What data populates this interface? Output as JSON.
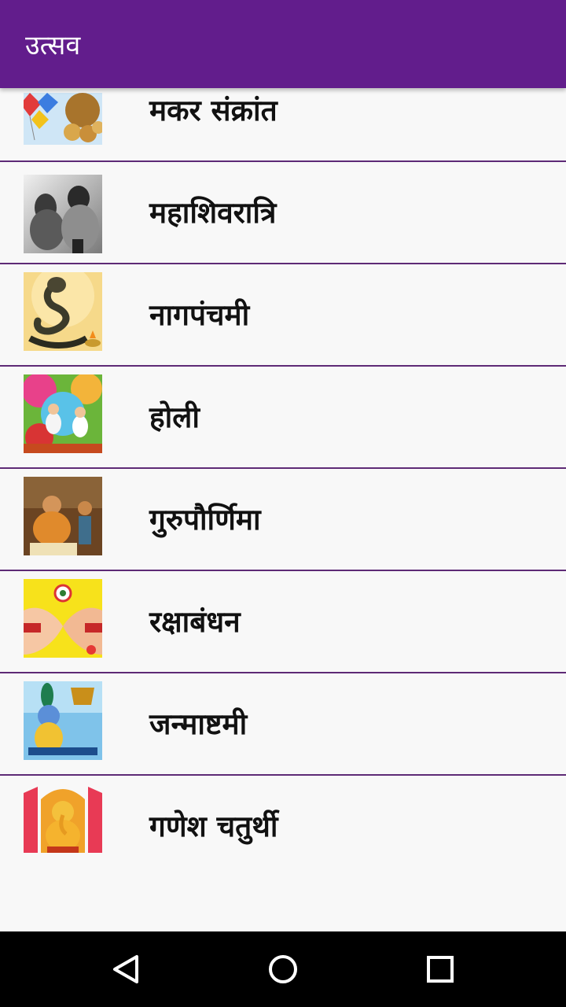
{
  "app_bar": {
    "title": "उत्सव",
    "color": "#621d8c"
  },
  "festivals": [
    {
      "name": "मकर संक्रांत",
      "icon": "kites-sweets-image"
    },
    {
      "name": "महाशिवरात्रि",
      "icon": "shiva-parvati-image"
    },
    {
      "name": "नागपंचमी",
      "icon": "cobra-lamp-image"
    },
    {
      "name": "होली",
      "icon": "holi-celebration-image"
    },
    {
      "name": "गुरुपौर्णिमा",
      "icon": "guru-disciple-image"
    },
    {
      "name": "रक्षाबंधन",
      "icon": "rakhi-hands-image"
    },
    {
      "name": "जन्माष्टमी",
      "icon": "krishna-image"
    },
    {
      "name": "गणेश चतुर्थी",
      "icon": "ganesha-image"
    }
  ],
  "nav_bar": {
    "back_icon": "back-triangle-icon",
    "home_icon": "home-circle-icon",
    "recents_icon": "recents-square-icon"
  }
}
